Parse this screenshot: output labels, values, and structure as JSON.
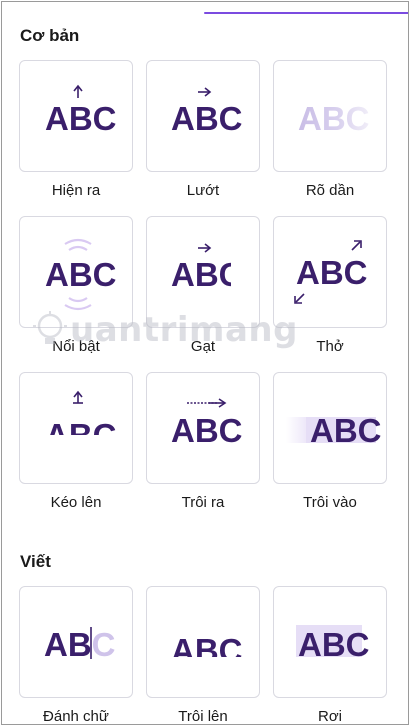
{
  "sections": {
    "basic": {
      "title": "Cơ bản"
    },
    "writing": {
      "title": "Viết"
    }
  },
  "effects": {
    "appear": "Hiện ra",
    "slide": "Lướt",
    "fade": "Rõ dần",
    "pop": "Nổi bật",
    "wipe": "Gạt",
    "breathe": "Thở",
    "rise": "Kéo lên",
    "pan": "Trôi ra",
    "drift_in": "Trôi vào",
    "typewriter": "Đánh chữ",
    "float_up": "Trôi lên",
    "fall": "Rơi"
  },
  "sample_text": "ABC",
  "watermark": "uantrimang",
  "colors": {
    "accent": "#7b4be0",
    "text_dark": "#3a1f6b",
    "tile_border": "#d9d9e1"
  }
}
